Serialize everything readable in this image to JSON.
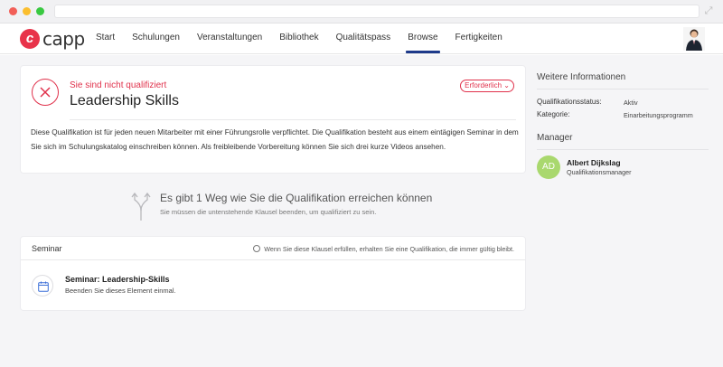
{
  "nav": {
    "logo_text": "capp",
    "items": [
      {
        "label": "Start",
        "active": false
      },
      {
        "label": "Schulungen",
        "active": false
      },
      {
        "label": "Veranstaltungen",
        "active": false
      },
      {
        "label": "Bibliothek",
        "active": false
      },
      {
        "label": "Qualitätspass",
        "active": false
      },
      {
        "label": "Browse",
        "active": true
      },
      {
        "label": "Fertigkeiten",
        "active": false
      }
    ]
  },
  "qualification": {
    "status": "Sie sind nicht qualifiziert",
    "title": "Leadership Skills",
    "badge": "Erforderlich",
    "description": "Diese Qualifikation ist für jeden neuen Mitarbeiter mit einer Führungsrolle verpflichtet. Die Qualifikation besteht aus einem eintägigen Seminar in dem Sie sich im Schulungskatalog einschreiben können. Als freibleibende Vorbereitung können Sie sich drei kurze Videos ansehen."
  },
  "path": {
    "title": "Es gibt 1 Weg wie Sie die Qualifikation erreichen können",
    "subtitle": "Sie müssen die untenstehende Klausel beenden, um qualifiziert zu sein."
  },
  "seminar": {
    "label": "Seminar",
    "note": "Wenn Sie diese Klausel erfüllen, erhalten Sie eine Qualifikation, die immer gültig bleibt.",
    "item_title": "Seminar: Leadership-Skills",
    "item_sub": "Beenden Sie dieses Element einmal."
  },
  "side": {
    "info_heading": "Weitere Informationen",
    "status_key": "Qualifikationsstatus:",
    "status_val": "Aktiv",
    "category_key": "Kategorie:",
    "category_val": "Einarbeitungsprogramm",
    "manager_heading": "Manager",
    "manager_initials": "AD",
    "manager_name": "Albert Dijkslag",
    "manager_role": "Qualifikationsmanager"
  },
  "colors": {
    "accent_red": "#e0314b",
    "nav_active": "#1e3a8a",
    "avatar_green": "#a9d86e"
  }
}
